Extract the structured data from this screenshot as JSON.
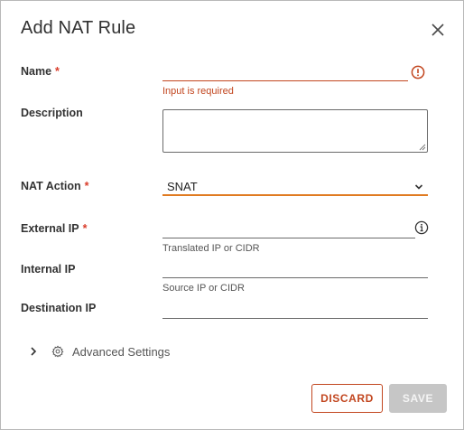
{
  "dialog": {
    "title": "Add NAT Rule"
  },
  "form": {
    "name": {
      "label": "Name",
      "required_mark": "*",
      "value": "",
      "error": "Input is required"
    },
    "description": {
      "label": "Description",
      "value": ""
    },
    "nat_action": {
      "label": "NAT Action",
      "required_mark": "*",
      "selected": "SNAT"
    },
    "external_ip": {
      "label": "External IP",
      "required_mark": "*",
      "value": "",
      "helper": "Translated IP or CIDR"
    },
    "internal_ip": {
      "label": "Internal IP",
      "value": "",
      "helper": "Source IP or CIDR"
    },
    "destination_ip": {
      "label": "Destination IP",
      "value": ""
    }
  },
  "advanced": {
    "label": "Advanced Settings"
  },
  "footer": {
    "discard_label": "DISCARD",
    "save_label": "SAVE"
  },
  "colors": {
    "error": "#c2461f",
    "focus": "#e07b21",
    "disabled_button": "#c6c6c6"
  }
}
